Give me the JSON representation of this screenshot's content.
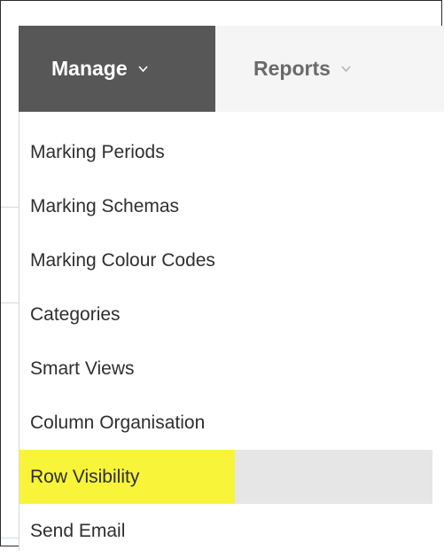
{
  "nav": {
    "tabs": [
      {
        "label": "Manage",
        "icon": "chevron-down-icon",
        "active": true
      },
      {
        "label": "Reports",
        "icon": "chevron-down-icon",
        "active": false
      }
    ]
  },
  "menu": {
    "items": [
      {
        "label": "Marking Periods"
      },
      {
        "label": "Marking Schemas"
      },
      {
        "label": "Marking Colour Codes"
      },
      {
        "label": "Categories"
      },
      {
        "label": "Smart Views"
      },
      {
        "label": "Column Organisation"
      },
      {
        "label": "Row Visibility",
        "hovered": true,
        "highlighted": true
      },
      {
        "label": "Send Email"
      }
    ]
  },
  "colors": {
    "active_tab_bg": "#575757",
    "nav_bg": "#f5f5f5",
    "hover_bg": "#e6e6e6",
    "highlight": "#f7f43a",
    "text": "#2f2f2f"
  }
}
